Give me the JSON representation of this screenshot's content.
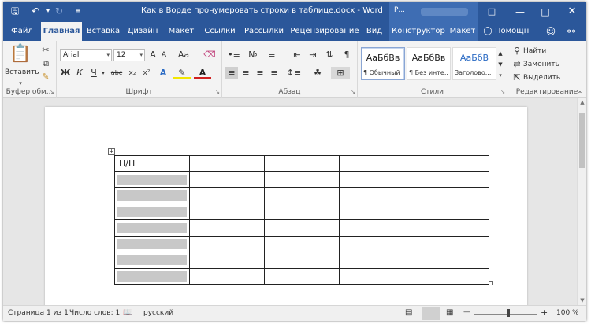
{
  "window": {
    "title": "Как в Ворде пронумеровать строки в таблице.docx - Word",
    "context_label": "Р..."
  },
  "tabs": [
    {
      "label": "Файл"
    },
    {
      "label": "Главная"
    },
    {
      "label": "Вставка"
    },
    {
      "label": "Дизайн"
    },
    {
      "label": "Макет"
    },
    {
      "label": "Ссылки"
    },
    {
      "label": "Рассылки"
    },
    {
      "label": "Рецензирование"
    },
    {
      "label": "Вид"
    },
    {
      "label": "Конструктор"
    },
    {
      "label": "Макет"
    },
    {
      "label": "Помощн"
    }
  ],
  "ribbon": {
    "clipboard": {
      "label": "Буфер обм...",
      "paste_label": "Вставить"
    },
    "font": {
      "label": "Шрифт",
      "name": "Arial",
      "size": "12",
      "bold": "Ж",
      "italic": "К",
      "underline": "Ч",
      "strike": "abc",
      "sub": "x₂",
      "sup": "x²",
      "case": "Aa",
      "grow": "A",
      "shrink": "A"
    },
    "paragraph": {
      "label": "Абзац"
    },
    "styles": {
      "label": "Стили",
      "items": [
        {
          "preview": "АаБбВв",
          "name": "¶ Обычный"
        },
        {
          "preview": "АаБбВв",
          "name": "¶ Без инте..."
        },
        {
          "preview": "АаБбВ",
          "name": "Заголово..."
        }
      ]
    },
    "editing": {
      "label": "Редактирование",
      "find": "Найти",
      "replace": "Заменить",
      "select": "Выделить"
    }
  },
  "table": {
    "header": "П/П",
    "rows": 8,
    "cols": 5
  },
  "status": {
    "page": "Страница 1 из 1",
    "words": "Число слов: 1",
    "language": "русский",
    "zoom": "100 %"
  }
}
